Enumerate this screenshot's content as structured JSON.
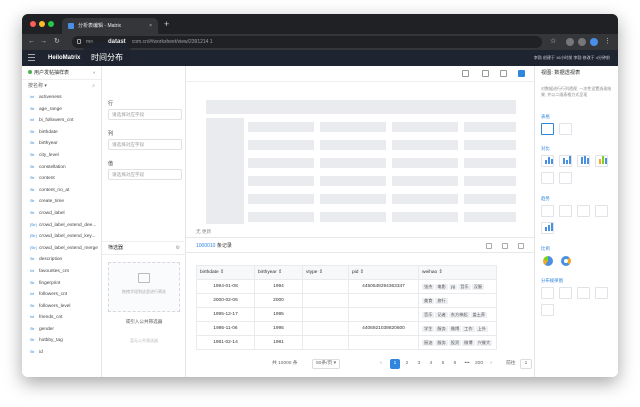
{
  "browser": {
    "tab_title": "分析表编辑 - Matrix",
    "new_tab": "+",
    "tab_close": "×",
    "url_prefix": "ma",
    "url_mid": "datast",
    "url_host": "com.cn/",
    "url_path": "#/worksheet/view/2391214 1"
  },
  "app": {
    "brand": "HeiloMatrix",
    "page_title": "时间分布",
    "header_right": "李勃 创建于 16小时前   李勃 修改于 4分钟前",
    "accent": "#2e86de"
  },
  "left_panel": {
    "dataset_name": "用户发帖抽样表",
    "sort_label": "按名称",
    "fields": [
      {
        "type": "Int",
        "name": "activeness"
      },
      {
        "type": "Str",
        "name": "age_range"
      },
      {
        "type": "Int",
        "name": "bi_followers_cnt"
      },
      {
        "type": "Str",
        "name": "birthdate"
      },
      {
        "type": "Str",
        "name": "birthyear"
      },
      {
        "type": "Str",
        "name": "city_level"
      },
      {
        "type": "Str",
        "name": "constellation"
      },
      {
        "type": "Str",
        "name": "content"
      },
      {
        "type": "Str",
        "name": "content_no_at"
      },
      {
        "type": "Str",
        "name": "create_time"
      },
      {
        "type": "Str",
        "name": "crowd_label"
      },
      {
        "type": "[Str]",
        "name": "crowd_label_extend_dee..."
      },
      {
        "type": "[Str]",
        "name": "crowd_label_extend_key..."
      },
      {
        "type": "[Str]",
        "name": "crowd_label_extend_merge"
      },
      {
        "type": "Str",
        "name": "description"
      },
      {
        "type": "Int",
        "name": "favourites_cnt"
      },
      {
        "type": "Str",
        "name": "fingerprint"
      },
      {
        "type": "Int",
        "name": "followers_cnt"
      },
      {
        "type": "Str",
        "name": "followers_level"
      },
      {
        "type": "Int",
        "name": "friends_cnt"
      },
      {
        "type": "Str",
        "name": "gender"
      },
      {
        "type": "Str",
        "name": "hotbby_tag"
      },
      {
        "type": "Str",
        "name": "id"
      }
    ]
  },
  "config": {
    "row_label": "行",
    "row_placeholder": "请选择对应字段",
    "col_label": "列",
    "col_placeholder": "请选择对应字段",
    "val_label": "值",
    "val_placeholder": "请选择对应字段",
    "filter_title": "筛选器",
    "filter_hint": "拖拽字段到这里进行筛选",
    "import_filter": "或引入公共筛选器",
    "empty_hint": "暂无公共筛选器"
  },
  "preview": {
    "note": "无 更新"
  },
  "records": {
    "count": "1000010",
    "suffix": "条记录"
  },
  "table": {
    "columns": [
      "birthdate",
      "birthyear",
      "vtype",
      "pid",
      "weihao"
    ],
    "rows": [
      {
        "birthdate": "1994-01-08",
        "birthyear": "1994",
        "vtype": "",
        "pid": "4450548294363347",
        "tags": [
          "张杰",
          "电影",
          "yg",
          "音乐",
          "汉服"
        ]
      },
      {
        "birthdate": "2000-02-06",
        "birthyear": "2000",
        "vtype": "",
        "pid": "",
        "tags": [
          "美食",
          "旅行"
        ]
      },
      {
        "birthdate": "1995-12-17",
        "birthyear": "1995",
        "vtype": "",
        "pid": "",
        "tags": [
          "音乐",
          "记者",
          "东方神起",
          "盖土养"
        ]
      },
      {
        "birthdate": "1995-11-06",
        "birthyear": "1995",
        "vtype": "",
        "pid": "4406921039820600",
        "tags": [
          "学生",
          "服务",
          "微博",
          "工作",
          "上外"
        ]
      },
      {
        "birthdate": "1981-02-14",
        "birthyear": "1981",
        "vtype": "",
        "pid": "",
        "tags": [
          "厨油",
          "服务",
          "投资",
          "微博",
          "兴餐大"
        ]
      }
    ]
  },
  "pager": {
    "total": "共 10000 条",
    "page_size": "50条/页",
    "prev": "‹",
    "next": "›",
    "pages": [
      "1",
      "2",
      "3",
      "4",
      "5",
      "6",
      "•••",
      "200"
    ],
    "current": "1",
    "goto_label": "前往",
    "goto_value": "1",
    "goto_suffix": "页"
  },
  "right_panel": {
    "title": "视图:  数据透视表",
    "description": "对数据进行行列透视, 一次性设置选现结果, 并以二维表格方式呈现",
    "sections": [
      "表格",
      "对比",
      "趋势",
      "比例",
      "分布规律图"
    ]
  }
}
